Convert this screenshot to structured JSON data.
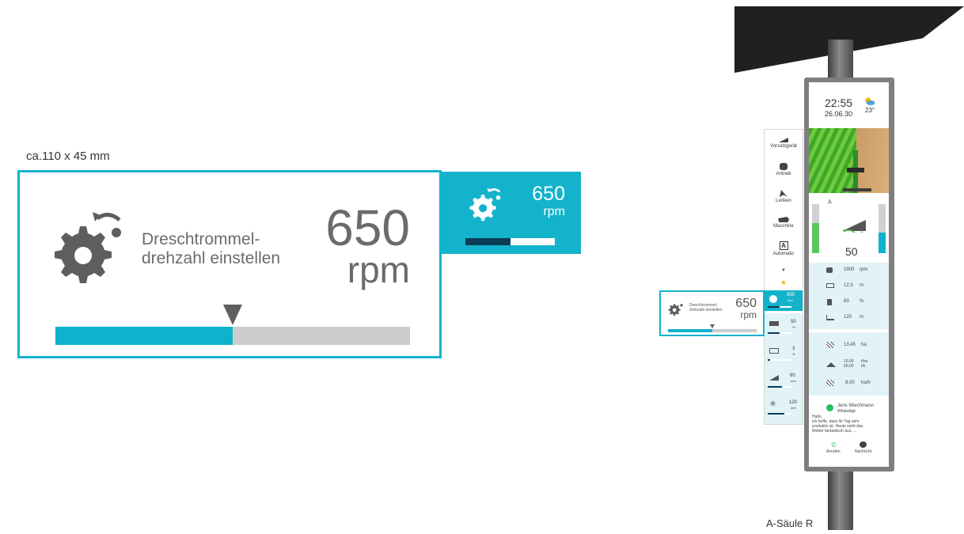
{
  "annotation": {
    "size_note": "ca.110 x 45 mm",
    "pillar_label": "A-Säule R"
  },
  "widget": {
    "title": "Dreschtrommel-\ndrehzahl einstellen",
    "value": "650",
    "unit": "rpm",
    "level_fraction": 0.5,
    "icon": "gear-rotate-icon",
    "accent_color": "#10b1cc"
  },
  "tile": {
    "value": "650",
    "unit": "rpm",
    "level_fraction": 0.5,
    "icon": "gear-rotate-icon"
  },
  "display": {
    "time": "22:55",
    "date": "26.06.30",
    "temperature": "23°",
    "header_bar_value": "50",
    "metrics": [
      {
        "icon": "engine-icon",
        "value": "1900",
        "unit": "rpm"
      },
      {
        "icon": "width-icon",
        "value": "12,3",
        "unit": "m"
      },
      {
        "icon": "fuel-icon",
        "value": "83",
        "unit": "%"
      },
      {
        "icon": "height-icon",
        "value": "120",
        "unit": "m"
      }
    ],
    "yield_stats": [
      {
        "icon": "area-icon",
        "value": "13,45",
        "unit": "ha"
      },
      {
        "icon": "scale-icon",
        "value": "10,00\n60,00",
        "unit": "t/ha\nt/h"
      },
      {
        "icon": "area-rate-icon",
        "value": "8,00",
        "unit": "ha/h"
      }
    ],
    "message": {
      "sender": "Jens Wiechmann",
      "app": "WhatsApp",
      "text": "Hallo,\nich hoffe, dass ihr Tag sehr\nproduktiv ist. Heute sieht das\nWetter fantastisch aus, ...",
      "call_label": "Anrufen",
      "reply_label": "Nachricht"
    }
  },
  "sidebar": {
    "items": [
      {
        "label": "Vorsatzgerät",
        "icon": "header-icon"
      },
      {
        "label": "Antrieb",
        "icon": "drive-icon"
      },
      {
        "label": "Lenken",
        "icon": "steering-icon"
      },
      {
        "label": "Maschine",
        "icon": "machine-icon"
      },
      {
        "label": "Automatic",
        "icon": "automatic-icon"
      }
    ],
    "favorites": [
      {
        "value": "650",
        "unit": "rpm",
        "level": 0.5
      },
      {
        "value": "50",
        "unit": "%",
        "level": 0.5
      },
      {
        "value": "3",
        "unit": "%",
        "level": 0.1
      },
      {
        "value": "80",
        "unit": "mm",
        "level": 0.6
      },
      {
        "value": "120",
        "unit": "mm",
        "level": 0.7
      }
    ]
  },
  "mini_widget": {
    "title": "Dreschtrommel-\ndrehzahl einstellen",
    "value": "650",
    "unit": "rpm",
    "level_fraction": 0.5
  }
}
